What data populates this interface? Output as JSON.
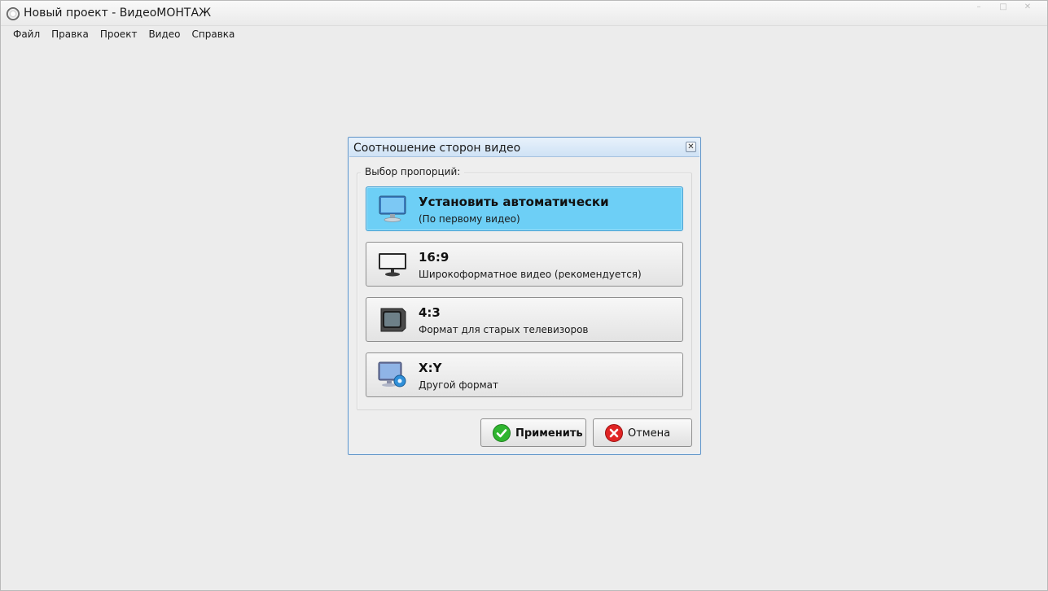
{
  "app": {
    "title": "Новый проект - ВидеоМОНТАЖ",
    "window_controls": [
      "–",
      "□",
      "✕"
    ]
  },
  "menu": [
    "Файл",
    "Правка",
    "Проект",
    "Видео",
    "Справка"
  ],
  "dialog": {
    "title": "Соотношение сторон видео",
    "close_icon": "✕",
    "group_label": "Выбор пропорций:",
    "options": [
      {
        "title": "Установить автоматически",
        "subtitle": "(По первому видео)",
        "icon": "monitor-blue-icon",
        "selected": true
      },
      {
        "title": "16:9",
        "subtitle": "Широкоформатное видео (рекомендуется)",
        "icon": "widescreen-monitor-icon",
        "selected": false
      },
      {
        "title": "4:3",
        "subtitle": "Формат для старых телевизоров",
        "icon": "crt-tv-icon",
        "selected": false
      },
      {
        "title": "X:Y",
        "subtitle": "Другой формат",
        "icon": "monitor-gear-icon",
        "selected": false
      }
    ],
    "apply_label": "Применить",
    "cancel_label": "Отмена"
  },
  "colors": {
    "selected_bg": "#6dcff6",
    "dialog_border": "#5f94c8",
    "apply_green": "#2fb52f",
    "cancel_red": "#e02424"
  }
}
